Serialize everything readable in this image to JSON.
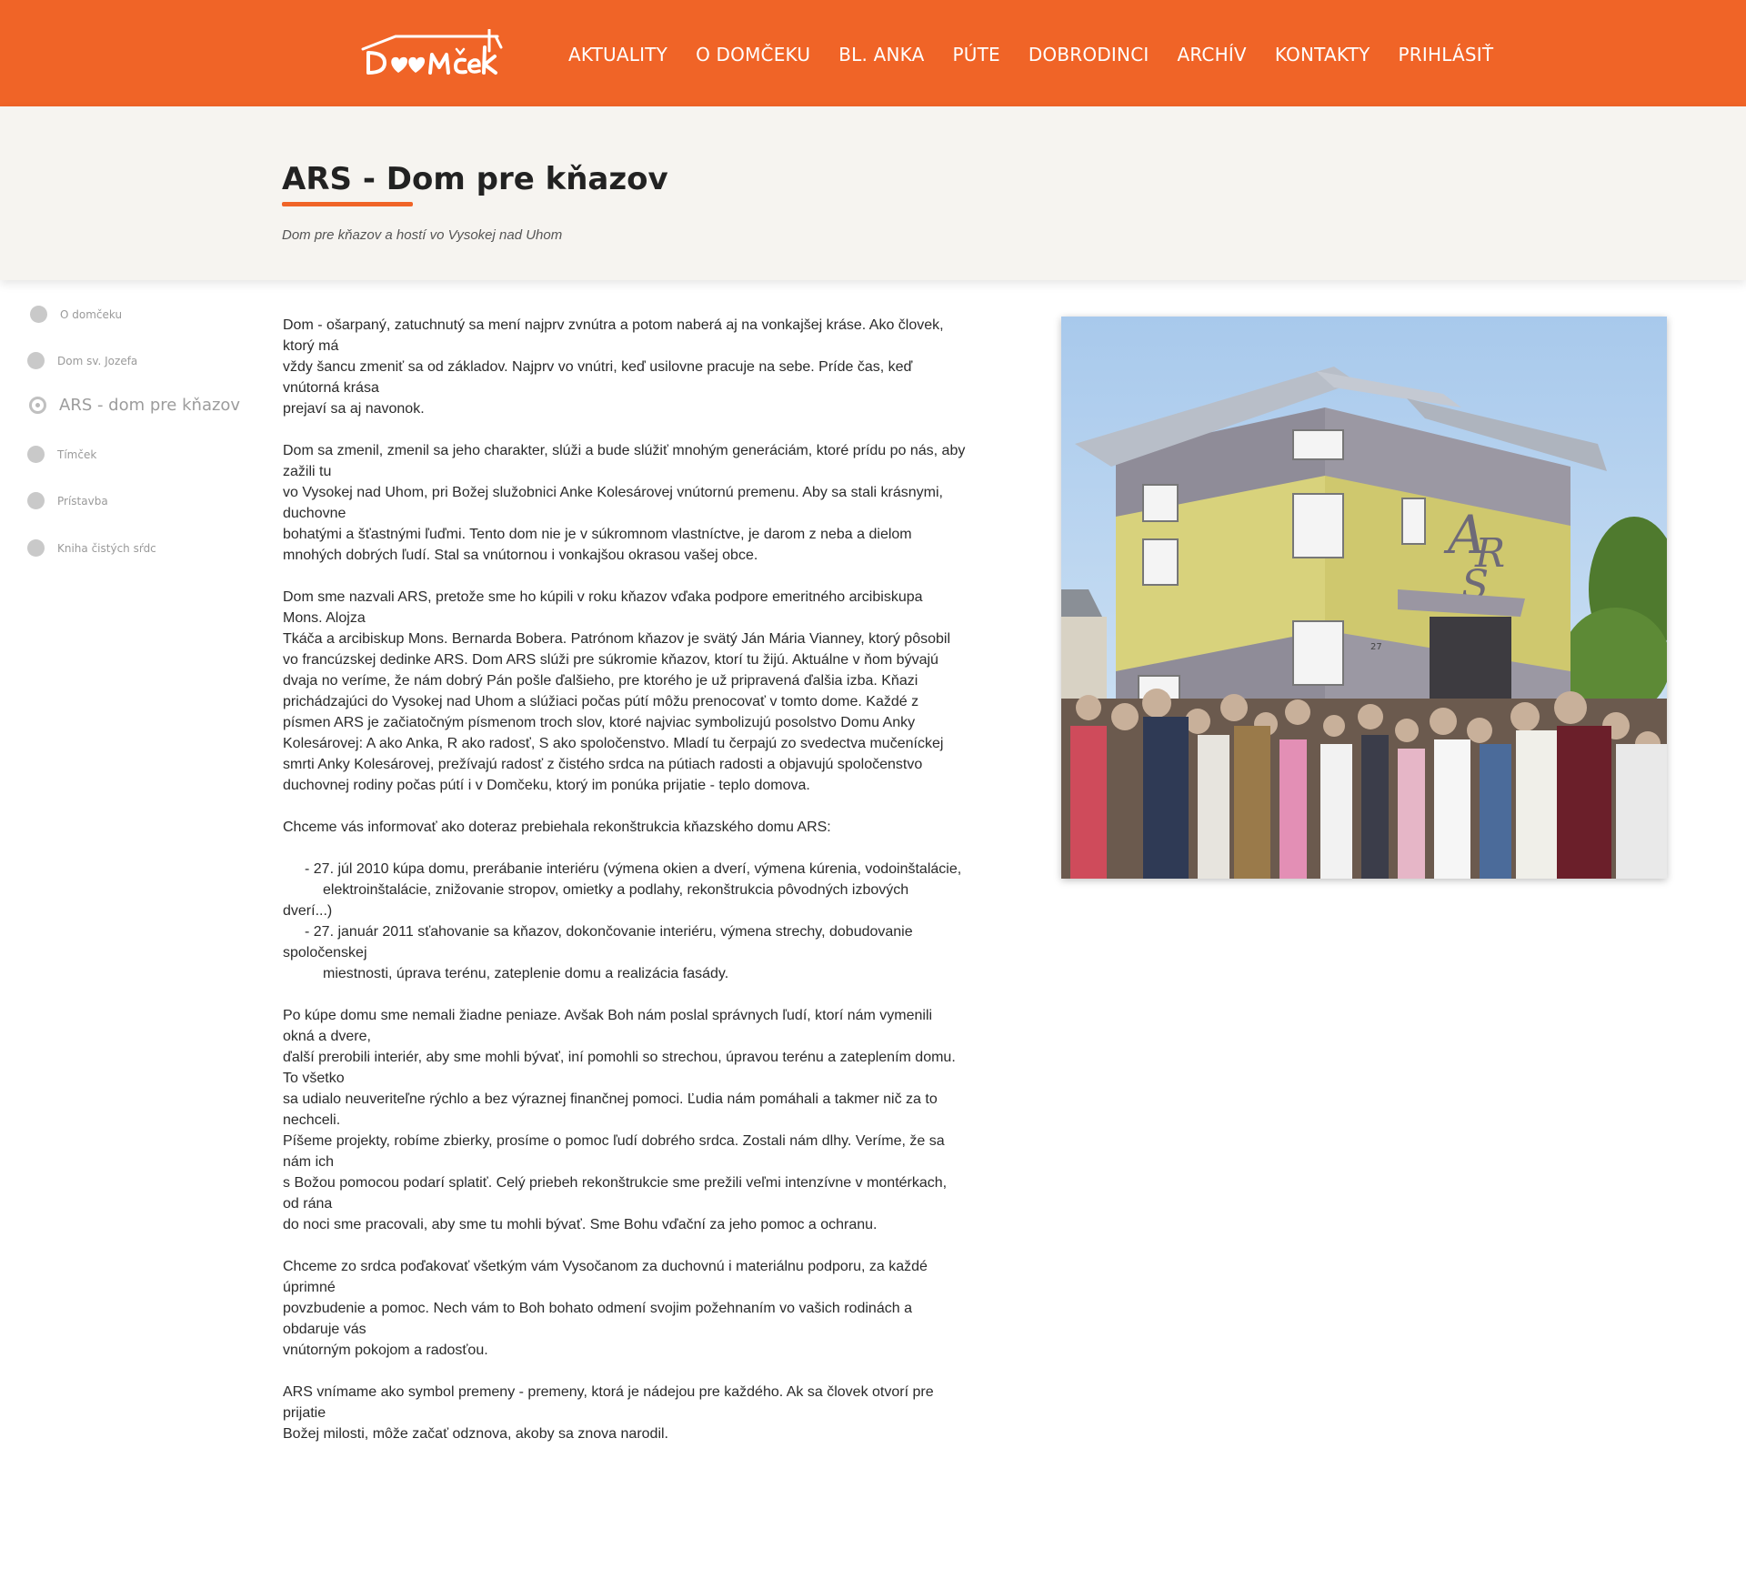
{
  "header": {
    "logo_text": "DOMčEK",
    "nav": [
      "AKTUALITY",
      "O DOMČEKU",
      "BL. ANKA",
      "PÚTE",
      "DOBRODINCI",
      "ARCHÍV",
      "KONTAKTY",
      "PRIHLÁSIŤ"
    ]
  },
  "hero": {
    "title": "ARS - Dom pre kňazov",
    "subtitle": "Dom pre kňazov a hostí vo Vysokej nad Uhom"
  },
  "sidebar": {
    "items": [
      {
        "label": "O domčeku",
        "active": false
      },
      {
        "label": "Dom sv. Jozefa",
        "active": false
      },
      {
        "label": "ARS - dom pre kňazov",
        "active": true
      },
      {
        "label": "Tímček",
        "active": false
      },
      {
        "label": "Prístavba",
        "active": false
      },
      {
        "label": "Kniha čistých sŕdc",
        "active": false
      }
    ]
  },
  "article": {
    "paragraphs": [
      [
        "Dom - ošarpaný, zatuchnutý sa mení najprv zvnútra a potom naberá aj na vonkajšej kráse.  Ako človek,",
        "ktorý má",
        "vždy šancu zmeniť sa od základov. Najprv vo vnútri, keď usilovne pracuje na sebe. Príde čas, keď",
        "vnútorná krása",
        "prejaví sa aj navonok."
      ],
      [
        "Dom sa zmenil, zmenil sa jeho charakter, slúži a bude slúžiť mnohým generáciám, ktoré prídu po nás, aby",
        "zažili tu",
        "vo Vysokej nad Uhom, pri Božej služobnici Anke Kolesárovej vnútornú premenu. Aby sa stali krásnymi,",
        "duchovne",
        "bohatými a šťastnými ľuďmi. Tento dom nie je v súkromnom vlastníctve, je darom z neba a dielom",
        "mnohých dobrých ľudí. Stal sa vnútornou i vonkajšou okrasou vašej obce."
      ],
      [
        "Dom sme nazvali ARS, pretože sme ho kúpili v roku kňazov vďaka podpore emeritného arcibiskupa",
        "Mons. Alojza",
        "Tkáča a arcibiskup Mons. Bernarda Bobera. Patrónom kňazov je svätý Ján Mária Vianney, ktorý pôsobil",
        "vo francúzskej dedinke ARS. Dom ARS slúži pre súkromie kňazov, ktorí tu žijú. Aktuálne v ňom bývajú",
        "dvaja no veríme, že nám dobrý Pán pošle ďalšieho, pre ktorého je už pripravená ďalšia izba. Kňazi",
        "prichádzajúci do Vysokej nad Uhom a slúžiaci počas pútí môžu prenocovať v tomto dome. Každé z",
        "písmen ARS je začiatočným písmenom troch slov, ktoré najviac symbolizujú posolstvo Domu Anky",
        "Kolesárovej: A ako Anka, R ako radosť, S ako spoločenstvo. Mladí tu čerpajú zo svedectva mučeníckej",
        "smrti Anky Kolesárovej, prežívajú radosť z čistého srdca na pútiach radosti a objavujú spoločenstvo",
        "duchovnej rodiny počas pútí i v Domčeku, ktorý im ponúka prijatie - teplo domova."
      ],
      [
        "Chceme vás informovať ako doteraz prebiehala rekonštrukcia kňazského domu ARS:"
      ]
    ],
    "timeline": [
      {
        "text": "- 27. júl 2010 kúpa domu, prerábanie interiéru (výmena okien a dverí, výmena kúrenia, vodoinštalácie,",
        "indent": 1
      },
      {
        "text": "elektroinštalácie, znižovanie stropov, omietky a podlahy, rekonštrukcia pôvodných izbových",
        "indent": 2
      },
      {
        "text": "dverí...)",
        "indent": 0
      },
      {
        "text": "- 27. január 2011 sťahovanie sa kňazov, dokončovanie interiéru, výmena strechy, dobudovanie",
        "indent": 1
      },
      {
        "text": "spoločenskej",
        "indent": 0
      },
      {
        "text": "miestnosti, úprava terénu, zateplenie domu a realizácia fasády.",
        "indent": 2
      }
    ],
    "paragraphs_after": [
      [
        "Po kúpe domu sme nemali žiadne peniaze. Avšak Boh nám poslal správnych ľudí, ktorí nám vymenili",
        "okná a dvere,",
        "ďalší prerobili interiér, aby sme mohli bývať, iní pomohli so strechou, úpravou terénu a zateplením domu.",
        "To všetko",
        "sa udialo neuveriteľne rýchlo a bez výraznej finančnej pomoci. Ľudia nám pomáhali a takmer nič za to",
        "nechceli.",
        "Píšeme projekty, robíme zbierky, prosíme o pomoc ľudí dobrého srdca. Zostali nám dlhy. Veríme, že sa",
        "nám ich",
        "s Božou pomocou podarí splatiť. Celý priebeh rekonštrukcie sme prežili veľmi intenzívne v montérkach,",
        "od rána",
        "do noci sme pracovali, aby sme tu mohli bývať. Sme Bohu vďační za jeho pomoc a ochranu."
      ],
      [
        "Chceme zo srdca poďakovať všetkým vám Vysočanom za duchovnú i materiálnu podporu, za každé",
        "úprimné",
        "povzbudenie a pomoc. Nech vám to Boh bohato odmení svojim požehnaním vo vašich rodinách a",
        "obdaruje vás",
        "vnútorným pokojom a radosťou."
      ],
      [
        "ARS vnímame ako symbol premeny - premeny, ktorá je nádejou pre každého. Ak sa človek otvorí pre",
        "prijatie",
        "Božej milosti, môže začať odznova, akoby sa znova narodil."
      ]
    ]
  },
  "photo": {
    "house_number": "27"
  },
  "colors": {
    "brand_orange": "#f06427",
    "hero_bg": "#f6f4f0",
    "sidebar_gray": "#9a9a9a"
  },
  "icons": {
    "sidebar_bullet": "circle-icon",
    "sidebar_active_bullet": "radio-selected-icon"
  }
}
